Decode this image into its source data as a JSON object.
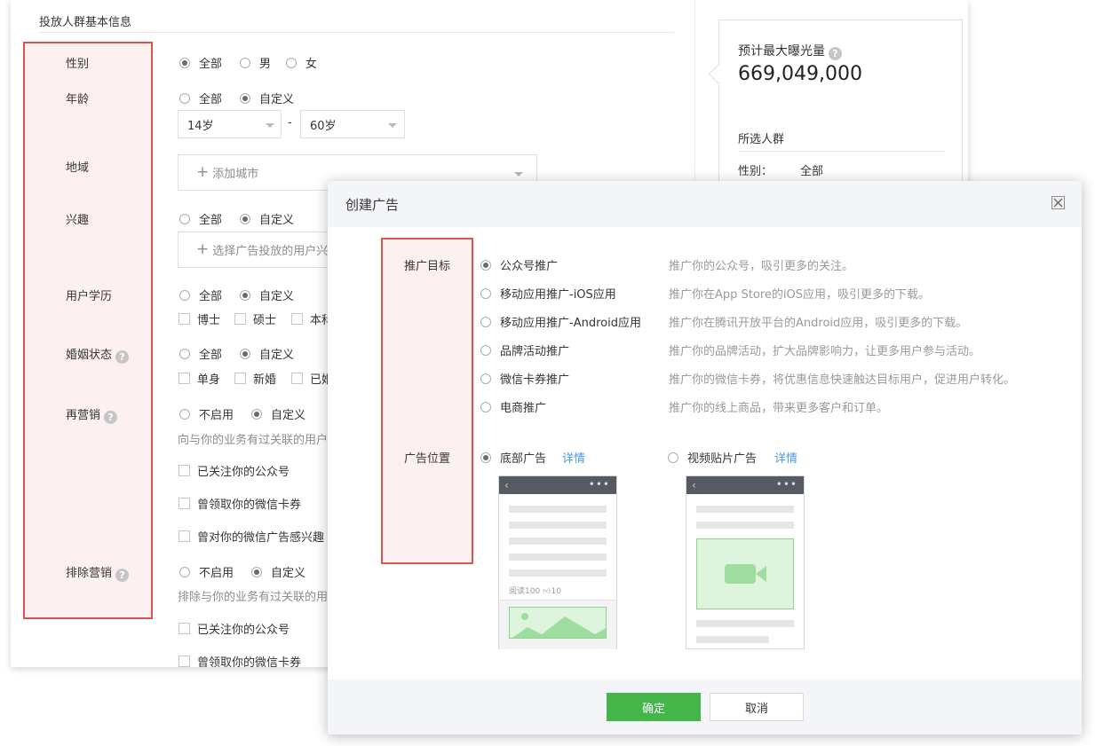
{
  "form": {
    "section_title": "投放人群基本信息",
    "fields": {
      "gender": {
        "label": "性别",
        "options": [
          "全部",
          "男",
          "女"
        ],
        "selected": "全部"
      },
      "age": {
        "label": "年龄",
        "options": [
          "全部",
          "自定义"
        ],
        "selected": "自定义",
        "min_value": "14岁",
        "range_separator": "-",
        "max_value": "60岁"
      },
      "region": {
        "label": "地域",
        "add_placeholder": "添加城市"
      },
      "interest": {
        "label": "兴趣",
        "options": [
          "全部",
          "自定义"
        ],
        "selected": "自定义",
        "add_placeholder": "选择广告投放的用户兴"
      },
      "education": {
        "label": "用户学历",
        "options": [
          "全部",
          "自定义"
        ],
        "selected": "自定义",
        "checkboxes": [
          "博士",
          "硕士",
          "本科"
        ]
      },
      "marital": {
        "label": "婚姻状态",
        "options": [
          "全部",
          "自定义"
        ],
        "selected": "自定义",
        "checkboxes": [
          "单身",
          "新婚",
          "已婚"
        ]
      },
      "remarketing": {
        "label": "再营销",
        "options": [
          "不启用",
          "自定义"
        ],
        "selected": "自定义",
        "hint": "向与你的业务有过关联的用户",
        "checkboxes": [
          "已关注你的公众号",
          "曾领取你的微信卡券",
          "曾对你的微信广告感兴趣"
        ]
      },
      "exclude": {
        "label": "排除营销",
        "options": [
          "不启用",
          "自定义"
        ],
        "selected": "自定义",
        "hint": "排除与你的业务有过关联的用",
        "checkboxes": [
          "已关注你的公众号",
          "曾领取你的微信卡券"
        ]
      }
    },
    "help_icon_glyph": "?"
  },
  "summary": {
    "exposure_label": "预计最大曝光量",
    "exposure_value": "669,049,000",
    "audience_title": "所选人群",
    "gender_key": "性别：",
    "gender_value": "全部"
  },
  "modal": {
    "title": "创建广告",
    "goal_label": "推广目标",
    "goals": [
      {
        "label": "公众号推广",
        "desc": "推广你的公众号，吸引更多的关注。",
        "checked": true
      },
      {
        "label": "移动应用推广-iOS应用",
        "desc": "推广你在App Store的iOS应用，吸引更多的下载。",
        "checked": false
      },
      {
        "label": "移动应用推广-Android应用",
        "desc": "推广你在腾讯开放平台的Android应用，吸引更多的下载。",
        "checked": false
      },
      {
        "label": "品牌活动推广",
        "desc": "推广你的品牌活动，扩大品牌影响力，让更多用户参与活动。",
        "checked": false
      },
      {
        "label": "微信卡券推广",
        "desc": "推广你的微信卡券，将优惠信息快速触达目标用户，促进用户转化。",
        "checked": false
      },
      {
        "label": "电商推广",
        "desc": "推广你的线上商品，带来更多客户和订单。",
        "checked": false
      }
    ],
    "position_label": "广告位置",
    "positions": [
      {
        "label": "底部广告",
        "detail": "详情",
        "checked": true
      },
      {
        "label": "视频贴片广告",
        "detail": "详情",
        "checked": false
      }
    ],
    "article_stats": {
      "reads": "阅读100",
      "likes": "10"
    },
    "ok_button": "确定",
    "cancel_button": "取消"
  },
  "colors": {
    "accent_green": "#44b549",
    "highlight_red": "#d9534f",
    "link_blue": "#459ae9"
  }
}
